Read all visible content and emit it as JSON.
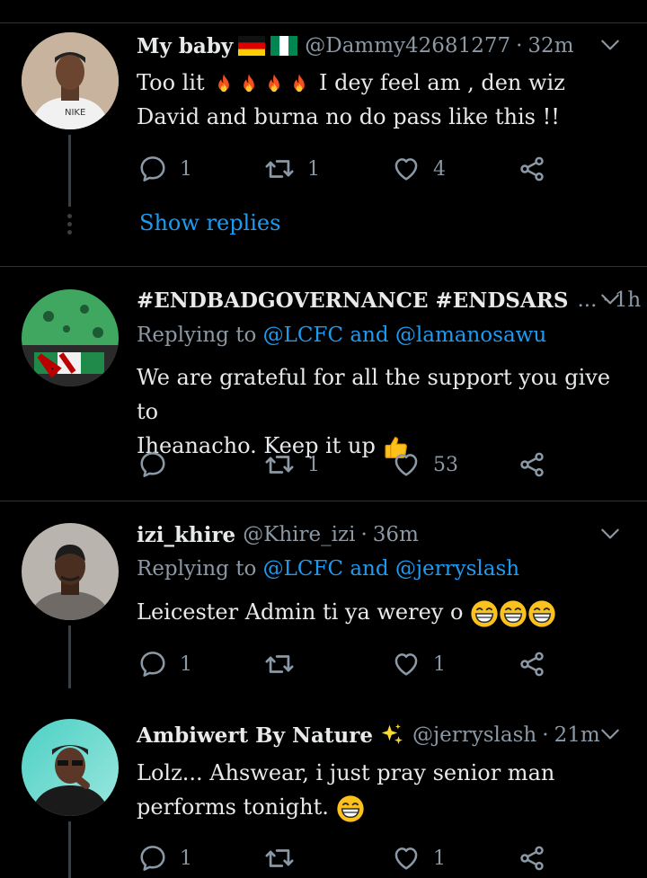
{
  "colors": {
    "background": "#000000",
    "text": "#e7e9ea",
    "muted": "#8b98a5",
    "link": "#1d9bf0",
    "divider": "#2f3336"
  },
  "tweets": [
    {
      "name": "My baby",
      "flags": [
        "germany-flag",
        "nigeria-flag"
      ],
      "handle": "@Dammy42681277",
      "separator": "·",
      "time": "32m",
      "replying_prefix": "",
      "replying_to": "",
      "line1": "Too lit",
      "line1_after": "I dey feel am , den wiz",
      "line2": "David and burna no do pass like this !!",
      "replies": "1",
      "retweets": "1",
      "likes": "4",
      "show_replies": "Show replies"
    },
    {
      "name": "#ENDBADGOVERNANCE #ENDSARS",
      "name_suffix": "...",
      "handle": "",
      "separator": "·",
      "time": "1h",
      "replying_prefix": "Replying to ",
      "replying_to": "@LCFC and @lamanosawu",
      "line1": "We are grateful for all the support you give to",
      "line2": "Iheanacho. Keep it up",
      "replies": "",
      "retweets": "1",
      "likes": "53"
    },
    {
      "name": "izi_khire",
      "handle": "@Khire_izi",
      "separator": "·",
      "time": "36m",
      "replying_prefix": "Replying to ",
      "replying_to": "@LCFC and @jerryslash",
      "line1": "Leicester Admin ti ya werey o",
      "replies": "1",
      "retweets": "",
      "likes": "1"
    },
    {
      "name": "Ambiwert By Nature",
      "handle": "@jerryslash",
      "separator": "·",
      "time": "21m",
      "line1": "Lolz... Ahswear, i just pray senior man",
      "line2": "performs tonight.",
      "replies": "1",
      "retweets": "",
      "likes": "1"
    }
  ]
}
